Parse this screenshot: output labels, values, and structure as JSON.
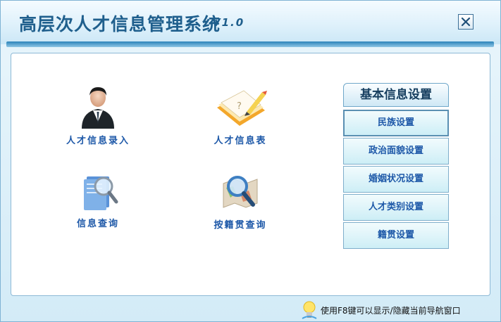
{
  "window": {
    "title": "高层次人才信息管理系统",
    "version": "V1.0",
    "close_label": "✕"
  },
  "modules": {
    "talent_entry": {
      "label": "人才信息录入",
      "icon": "businessman-icon"
    },
    "talent_table": {
      "label": "人才信息表",
      "icon": "notebook-pencil-icon"
    },
    "info_query": {
      "label": "信息查询",
      "icon": "document-magnifier-icon"
    },
    "native_place_query": {
      "label": "按籍贯查询",
      "icon": "map-magnifier-icon"
    }
  },
  "settings_panel": {
    "title": "基本信息设置",
    "items": [
      {
        "label": "民族设置"
      },
      {
        "label": "政治面貌设置"
      },
      {
        "label": "婚姻状况设置"
      },
      {
        "label": "人才类别设置"
      },
      {
        "label": "籍贯设置"
      }
    ]
  },
  "statusbar": {
    "hint": "使用F8键可以显示/隐藏当前导航窗口",
    "icon": "lightbulb-icon"
  },
  "colors": {
    "accent": "#1d58a8",
    "title": "#1f5f8d",
    "divider": "#2b83b9"
  }
}
